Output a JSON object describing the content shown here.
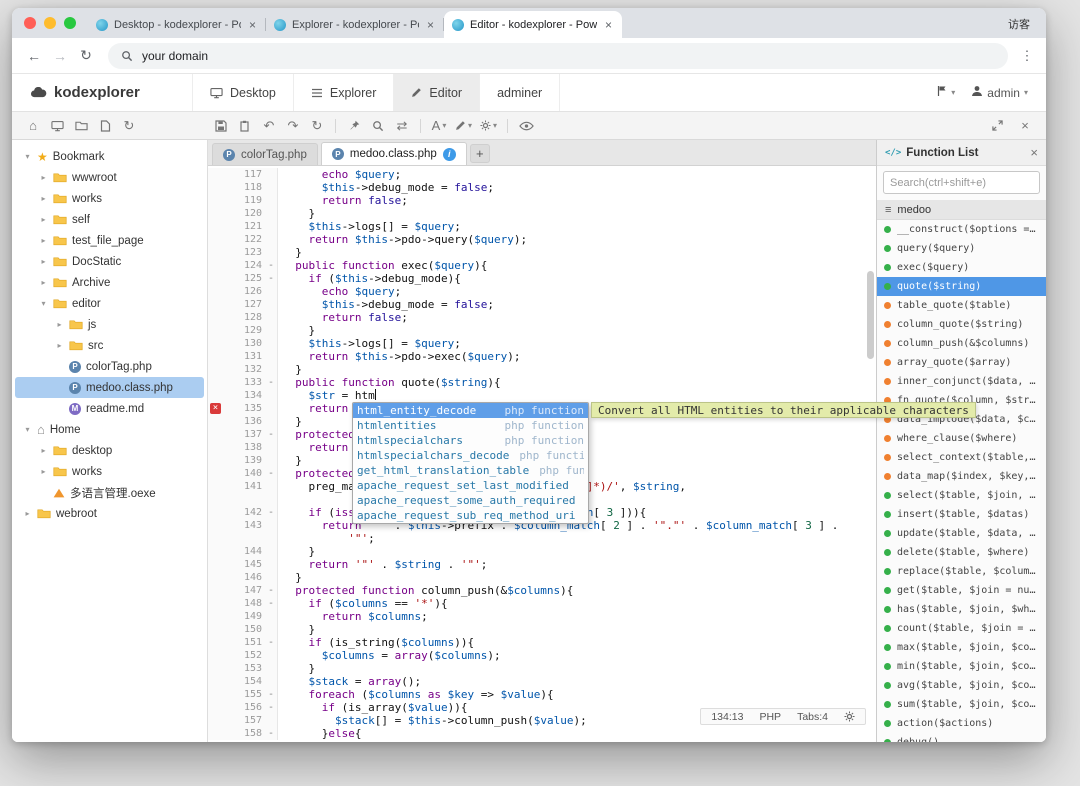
{
  "colors": {
    "accent": "#4f97e6",
    "tree_selection": "#abcdf1",
    "public_dot": "#35b04a",
    "protected_dot": "#f08030",
    "error_red": "#d93a3a",
    "tooltip_bg": "#e3ebaa"
  },
  "browser": {
    "tabs": [
      {
        "title": "Desktop - kodexplorer - Power",
        "active": false
      },
      {
        "title": "Explorer - kodexplorer - Powe",
        "active": false
      },
      {
        "title": "Editor - kodexplorer - Powered",
        "active": true
      }
    ],
    "guest_label": "访客",
    "url": "your domain"
  },
  "app_header": {
    "logo": "kodexplorer",
    "nav": [
      {
        "label": "Desktop",
        "icon": "desktop",
        "icon_name": "desktop-icon",
        "active": false
      },
      {
        "label": "Explorer",
        "icon": "list",
        "icon_name": "explorer-list-icon",
        "active": false
      },
      {
        "label": "Editor",
        "icon": "pencil",
        "icon_name": "editor-pencil-icon",
        "active": true
      },
      {
        "label": "adminer",
        "icon": "",
        "icon_name": "",
        "active": false
      }
    ],
    "user": "admin"
  },
  "toolbar": {
    "left_icons": [
      {
        "name": "home-icon",
        "glyph": "home"
      },
      {
        "name": "desktop-icon",
        "glyph": "desktop"
      },
      {
        "name": "new-folder-icon",
        "glyph": "folder"
      },
      {
        "name": "new-file-icon",
        "glyph": "file"
      },
      {
        "name": "refresh-icon",
        "glyph": "refresh"
      }
    ],
    "editor_icons": [
      {
        "name": "save-icon",
        "glyph": "save"
      },
      {
        "name": "paste-icon",
        "glyph": "paste"
      },
      {
        "name": "undo-icon",
        "glyph": "undo"
      },
      {
        "name": "redo-icon",
        "glyph": "redo"
      },
      {
        "name": "reload-icon",
        "glyph": "refresh"
      },
      {
        "name": "divider"
      },
      {
        "name": "pin-icon",
        "glyph": "pin"
      },
      {
        "name": "search-icon",
        "glyph": "search"
      },
      {
        "name": "goto-swap-icon",
        "glyph": "swap"
      },
      {
        "name": "divider"
      },
      {
        "name": "font-size-button",
        "text": "A",
        "caret": true
      },
      {
        "name": "theme-button",
        "glyph": "pencil",
        "caret": true
      },
      {
        "name": "settings-button",
        "glyph": "gear",
        "caret": true
      },
      {
        "name": "divider"
      },
      {
        "name": "preview-eye-icon",
        "glyph": "eye"
      }
    ],
    "window_icons": [
      {
        "name": "fullscreen-icon",
        "glyph": "expand"
      },
      {
        "name": "close-editor-icon",
        "text": "×"
      }
    ]
  },
  "sidebar": {
    "items": [
      {
        "label": "Bookmark",
        "depth": 0,
        "icon": "star",
        "chevron": "expanded"
      },
      {
        "label": "wwwroot",
        "depth": 1,
        "icon": "folder",
        "chevron": "collapsed"
      },
      {
        "label": "works",
        "depth": 1,
        "icon": "folder",
        "chevron": "collapsed"
      },
      {
        "label": "self",
        "depth": 1,
        "icon": "folder",
        "chevron": "collapsed"
      },
      {
        "label": "test_file_page",
        "depth": 1,
        "icon": "folder",
        "chevron": "collapsed"
      },
      {
        "label": "DocStatic",
        "depth": 1,
        "icon": "folder",
        "chevron": "collapsed"
      },
      {
        "label": "Archive",
        "depth": 1,
        "icon": "folder",
        "chevron": "collapsed"
      },
      {
        "label": "editor",
        "depth": 1,
        "icon": "folder",
        "chevron": "expanded"
      },
      {
        "label": "js",
        "depth": 2,
        "icon": "folder",
        "chevron": "collapsed"
      },
      {
        "label": "src",
        "depth": 2,
        "icon": "folder",
        "chevron": "collapsed"
      },
      {
        "label": "colorTag.php",
        "depth": 2,
        "icon": "php",
        "chevron": ""
      },
      {
        "label": "medoo.class.php",
        "depth": 2,
        "icon": "php",
        "chevron": "",
        "selected": true
      },
      {
        "label": "readme.md",
        "depth": 2,
        "icon": "md",
        "chevron": ""
      },
      {
        "label": "Home",
        "depth": 0,
        "icon": "home",
        "chevron": "expanded"
      },
      {
        "label": "desktop",
        "depth": 1,
        "icon": "folder",
        "chevron": "collapsed"
      },
      {
        "label": "works",
        "depth": 1,
        "icon": "folder",
        "chevron": "collapsed"
      },
      {
        "label": "多语言管理.oexe",
        "depth": 1,
        "icon": "oexe",
        "chevron": ""
      },
      {
        "label": "webroot",
        "depth": 0,
        "icon": "folder",
        "chevron": "collapsed"
      }
    ]
  },
  "editor": {
    "tabs": [
      {
        "label": "colorTag.php",
        "active": false
      },
      {
        "label": "medoo.class.php",
        "active": true,
        "badge": "i"
      }
    ],
    "new_tab_label": "+",
    "lines": [
      {
        "n": 117,
        "t": "      echo $query;"
      },
      {
        "n": 118,
        "t": "      $this->debug_mode = false;"
      },
      {
        "n": 119,
        "t": "      return false;"
      },
      {
        "n": 120,
        "t": "    }"
      },
      {
        "n": 121,
        "t": "    $this->logs[] = $query;"
      },
      {
        "n": 122,
        "t": "    return $this->pdo->query($query);"
      },
      {
        "n": 123,
        "t": "  }"
      },
      {
        "n": 124,
        "f": 1,
        "t": "  public function exec($query){"
      },
      {
        "n": 125,
        "f": 1,
        "t": "    if ($this->debug_mode){"
      },
      {
        "n": 126,
        "t": "      echo $query;"
      },
      {
        "n": 127,
        "t": "      $this->debug_mode = false;"
      },
      {
        "n": 128,
        "t": "      return false;"
      },
      {
        "n": 129,
        "t": "    }"
      },
      {
        "n": 130,
        "t": "    $this->logs[] = $query;"
      },
      {
        "n": 131,
        "t": "    return $this->pdo->exec($query);"
      },
      {
        "n": 132,
        "t": "  }"
      },
      {
        "n": 133,
        "f": 1,
        "t": "  public function quote($string){"
      },
      {
        "n": 134,
        "caret": true,
        "t": "    $str = htm"
      },
      {
        "n": 135,
        "err": 1,
        "t": "    return $this->pdo->quote($string);"
      },
      {
        "n": 136,
        "t": "  }"
      },
      {
        "n": 137,
        "f": 1,
        "t": "  protected function table_quote($table){"
      },
      {
        "n": 138,
        "t": "    return '\"' . $this->prefix . $table . '\"';"
      },
      {
        "n": 139,
        "t": "  }"
      },
      {
        "n": 140,
        "f": 1,
        "t": "  protected function column_quote($string){"
      },
      {
        "n": 141,
        "t": "    preg_match('/([a-zA-Z0-9_]*)\\.([a-zA-Z0-9_]*)/', $string,",
        "w": "              $column_match);"
      },
      {
        "n": 142,
        "f": 1,
        "t": "    if (isset($column_match[ 2 ], $column_match[ 3 ])){"
      },
      {
        "n": 143,
        "t": "      return '\"' . $this->prefix . $column_match[ 2 ] . '\".\"' . $column_match[ 3 ] .",
        "w": "          '\"';"
      },
      {
        "n": 144,
        "t": "    }"
      },
      {
        "n": 145,
        "t": "    return '\"' . $string . '\"';"
      },
      {
        "n": 146,
        "t": "  }"
      },
      {
        "n": 147,
        "f": 1,
        "t": "  protected function column_push(&$columns){"
      },
      {
        "n": 148,
        "f": 1,
        "t": "    if ($columns == '*'){"
      },
      {
        "n": 149,
        "t": "      return $columns;"
      },
      {
        "n": 150,
        "t": "    }"
      },
      {
        "n": 151,
        "f": 1,
        "t": "    if (is_string($columns)){"
      },
      {
        "n": 152,
        "t": "      $columns = array($columns);"
      },
      {
        "n": 153,
        "t": "    }"
      },
      {
        "n": 154,
        "t": "    $stack = array();"
      },
      {
        "n": 155,
        "f": 1,
        "t": "    foreach ($columns as $key => $value){"
      },
      {
        "n": 156,
        "f": 1,
        "t": "      if (is_array($value)){"
      },
      {
        "n": 157,
        "t": "        $stack[] = $this->column_push($value);"
      },
      {
        "n": 158,
        "f": 1,
        "t": "      }else{"
      }
    ],
    "autocomplete": {
      "items": [
        {
          "name": "html_entity_decode",
          "type": "php function",
          "selected": true
        },
        {
          "name": "htmlentities",
          "type": "php function"
        },
        {
          "name": "htmlspecialchars",
          "type": "php function"
        },
        {
          "name": "htmlspecialchars_decode",
          "type": "php function"
        },
        {
          "name": "get_html_translation_table",
          "type": "php function"
        },
        {
          "name": "apache_request_set_last_modified",
          "type": ""
        },
        {
          "name": "apache_request_some_auth_required",
          "type": ""
        },
        {
          "name": "apache_request_sub_req_method_uri",
          "type": ""
        }
      ],
      "tooltip": "Convert all HTML entities to their applicable characters"
    },
    "status": {
      "cursor": "134:13",
      "mode": "PHP",
      "tabs": "Tabs:4"
    }
  },
  "function_panel": {
    "icon": "</>",
    "title": "Function List",
    "close_label": "×",
    "search_placeholder": "Search(ctrl+shift+e)",
    "class_name": "medoo",
    "items": [
      {
        "label": "__construct($options = null)",
        "vis": "public"
      },
      {
        "label": "query($query)",
        "vis": "public"
      },
      {
        "label": "exec($query)",
        "vis": "public"
      },
      {
        "label": "quote($string)",
        "vis": "public",
        "selected": true
      },
      {
        "label": "table_quote($table)",
        "vis": "protected"
      },
      {
        "label": "column_quote($string)",
        "vis": "protected"
      },
      {
        "label": "column_push(&$columns)",
        "vis": "protected"
      },
      {
        "label": "array_quote($array)",
        "vis": "protected"
      },
      {
        "label": "inner_conjunct($data, $conjunctor, $outer_conjunctor)",
        "vis": "protected"
      },
      {
        "label": "fn_quote($column, $string)",
        "vis": "protected"
      },
      {
        "label": "data_implode($data, $conjunctor)",
        "vis": "protected"
      },
      {
        "label": "where_clause($where)",
        "vis": "protected"
      },
      {
        "label": "select_context($table, $join, &$columns = null, $where = null)",
        "vis": "protected"
      },
      {
        "label": "data_map($index, $key, $value, $data, &$stack)",
        "vis": "protected"
      },
      {
        "label": "select($table, $join, $columns = null, $where = null)",
        "vis": "public"
      },
      {
        "label": "insert($table, $datas)",
        "vis": "public"
      },
      {
        "label": "update($table, $data, $where = null)",
        "vis": "public"
      },
      {
        "label": "delete($table, $where)",
        "vis": "public"
      },
      {
        "label": "replace($table, $columns, $search = null)",
        "vis": "public"
      },
      {
        "label": "get($table, $join = null, $column = null)",
        "vis": "public"
      },
      {
        "label": "has($table, $join, $where = null)",
        "vis": "public"
      },
      {
        "label": "count($table, $join = null, $column = null)",
        "vis": "public"
      },
      {
        "label": "max($table, $join, $column = null)",
        "vis": "public"
      },
      {
        "label": "min($table, $join, $column = null)",
        "vis": "public"
      },
      {
        "label": "avg($table, $join, $column = null)",
        "vis": "public"
      },
      {
        "label": "sum($table, $join, $column = null)",
        "vis": "public"
      },
      {
        "label": "action($actions)",
        "vis": "public"
      },
      {
        "label": "debug()",
        "vis": "public"
      }
    ]
  }
}
